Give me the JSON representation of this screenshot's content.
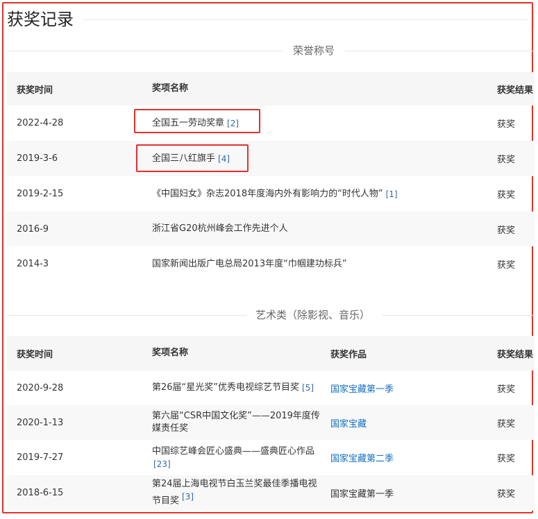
{
  "page_title": "获奖记录",
  "sections": [
    {
      "heading": "荣誉称号",
      "columns": [
        "获奖时间",
        "奖项名称",
        "获奖结果"
      ],
      "rows": [
        {
          "date": "2022-4-28",
          "name": "全国五一劳动奖章",
          "ref": "[2]",
          "result": "获奖"
        },
        {
          "date": "2019-3-6",
          "name": "全国三八红旗手",
          "ref": "[4]",
          "result": "获奖"
        },
        {
          "date": "2019-2-15",
          "name": "《中国妇女》杂志2018年度海内外有影响力的“时代人物”",
          "ref": "[1]",
          "result": "获奖"
        },
        {
          "date": "2016-9",
          "name": "浙江省G20杭州峰会工作先进个人",
          "ref": "",
          "result": "获奖"
        },
        {
          "date": "2014-3",
          "name": "国家新闻出版广电总局2013年度“巾帼建功标兵”",
          "ref": "",
          "result": "获奖"
        }
      ]
    },
    {
      "heading": "艺术类（除影视、音乐）",
      "columns": [
        "获奖时间",
        "奖项名称",
        "获奖作品",
        "获奖结果"
      ],
      "rows": [
        {
          "date": "2020-9-28",
          "name": "第26届“星光奖”优秀电视综艺节目奖",
          "ref": "[5]",
          "work": "国家宝藏第一季",
          "result": "获奖"
        },
        {
          "date": "2020-1-13",
          "name": "第六届“CSR中国文化奖”——2019年度传媒责任奖",
          "ref": "",
          "work": "国家宝藏",
          "result": "获奖"
        },
        {
          "date": "2019-7-27",
          "name": "中国综艺峰会匠心盛典——盛典匠心作品",
          "ref": "[23]",
          "work": "国家宝藏第二季",
          "result": "获奖"
        },
        {
          "date": "2018-6-15",
          "name": "第24届上海电视节白玉兰奖最佳季播电视节目奖",
          "ref": "[3]",
          "work": "国家宝藏第一季",
          "result": "获奖"
        }
      ]
    }
  ],
  "colors": {
    "highlight": "#e0312b",
    "link": "#136ec2",
    "ref": "#3366aa"
  }
}
